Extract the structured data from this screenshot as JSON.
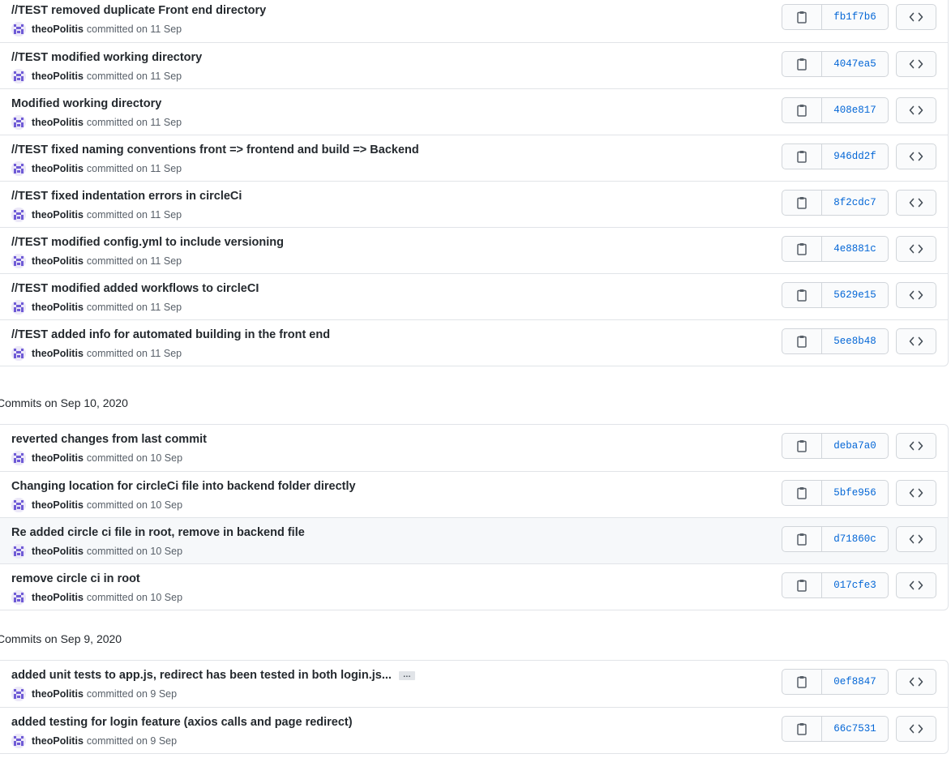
{
  "groups": [
    {
      "heading": "",
      "commits": [
        {
          "message": "//TEST removed duplicate Front end directory",
          "author": "theoPolitis",
          "meta": "committed on 11 Sep",
          "sha": "fb1f7b6"
        },
        {
          "message": "//TEST modified working directory",
          "author": "theoPolitis",
          "meta": "committed on 11 Sep",
          "sha": "4047ea5"
        },
        {
          "message": "Modified working directory",
          "author": "theoPolitis",
          "meta": "committed on 11 Sep",
          "sha": "408e817"
        },
        {
          "message": "//TEST fixed naming conventions front => frontend and build => Backend",
          "author": "theoPolitis",
          "meta": "committed on 11 Sep",
          "sha": "946dd2f"
        },
        {
          "message": "//TEST fixed indentation errors in circleCi",
          "author": "theoPolitis",
          "meta": "committed on 11 Sep",
          "sha": "8f2cdc7"
        },
        {
          "message": "//TEST modified config.yml to include versioning",
          "author": "theoPolitis",
          "meta": "committed on 11 Sep",
          "sha": "4e8881c"
        },
        {
          "message": "//TEST modified added workflows to circleCI",
          "author": "theoPolitis",
          "meta": "committed on 11 Sep",
          "sha": "5629e15"
        },
        {
          "message": "//TEST added info for automated building in the front end",
          "author": "theoPolitis",
          "meta": "committed on 11 Sep",
          "sha": "5ee8b48"
        }
      ]
    },
    {
      "heading": "Commits on Sep 10, 2020",
      "commits": [
        {
          "message": "reverted changes from last commit",
          "author": "theoPolitis",
          "meta": "committed on 10 Sep",
          "sha": "deba7a0"
        },
        {
          "message": "Changing location for circleCi file into backend folder directly",
          "author": "theoPolitis",
          "meta": "committed on 10 Sep",
          "sha": "5bfe956"
        },
        {
          "message": "Re added circle ci file in root, remove in backend file",
          "author": "theoPolitis",
          "meta": "committed on 10 Sep",
          "sha": "d71860c"
        },
        {
          "message": "remove circle ci in root",
          "author": "theoPolitis",
          "meta": "committed on 10 Sep",
          "sha": "017cfe3"
        }
      ]
    },
    {
      "heading": "Commits on Sep 9, 2020",
      "commits": [
        {
          "message": "added unit tests to app.js, redirect has been tested in both login.js...",
          "author": "theoPolitis",
          "meta": "committed on 9 Sep",
          "sha": "0ef8847",
          "expand_label": "…"
        },
        {
          "message": "added testing for login feature (axios calls and page redirect)",
          "author": "theoPolitis",
          "meta": "committed on 9 Sep",
          "sha": "66c7531"
        }
      ]
    }
  ],
  "icons": {
    "copy": "clipboard-icon",
    "browse": "code-icon",
    "avatar": "identicon-avatar"
  },
  "colors": {
    "sha_link": "#0366d6",
    "avatar": "#6f5bd6",
    "border": "#e1e4e8"
  }
}
